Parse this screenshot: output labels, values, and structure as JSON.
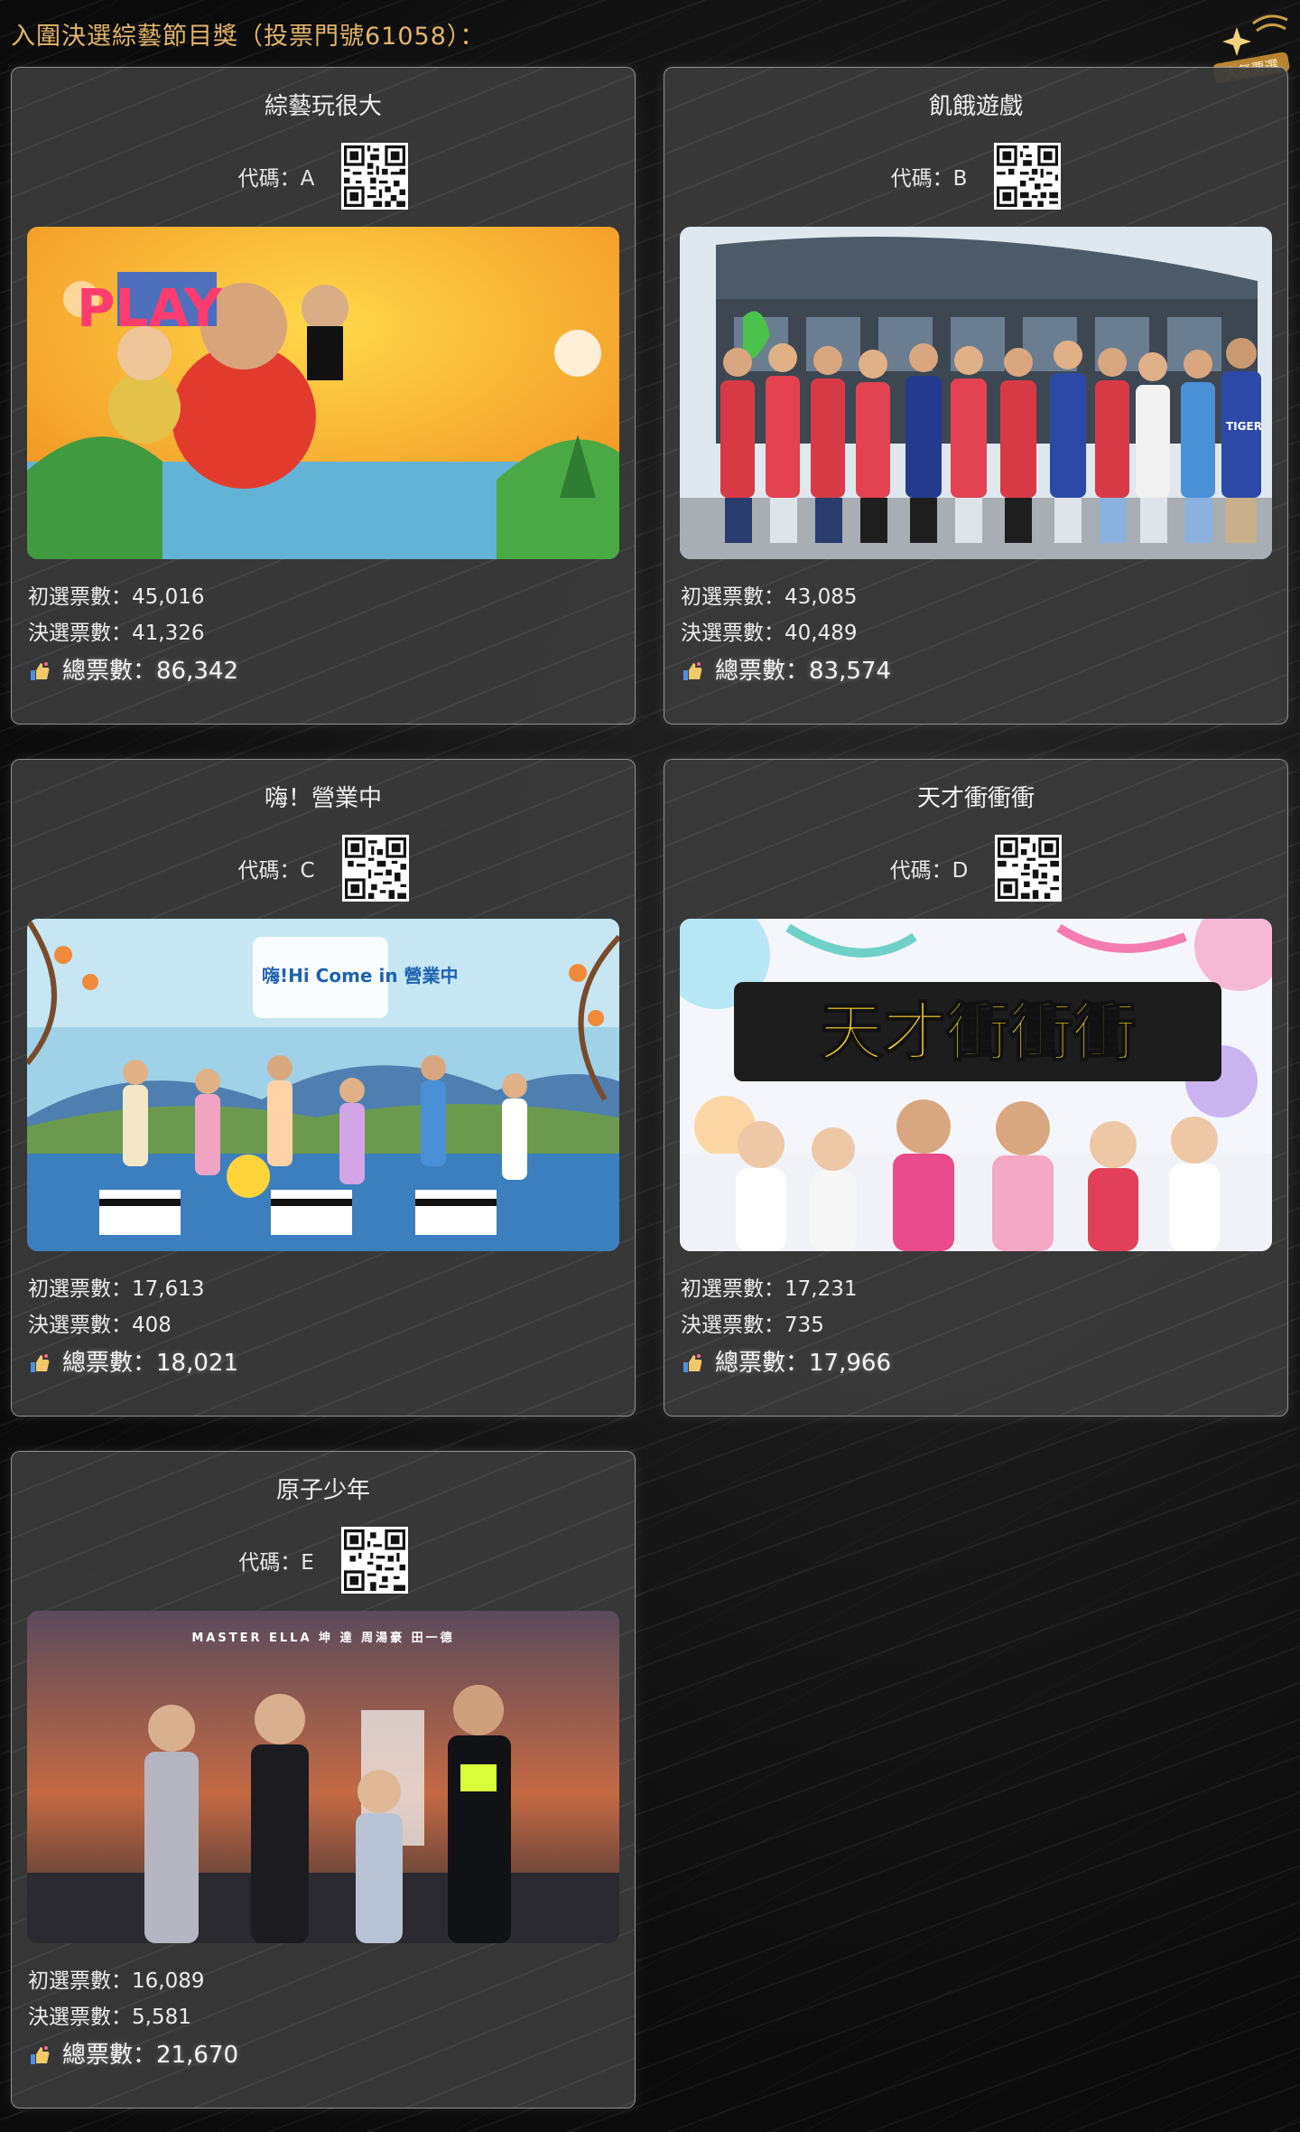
{
  "header": {
    "title": "入圍決選綜藝節目獎（投票門號61058）：",
    "badge_text": "人氣票選"
  },
  "labels": {
    "code_prefix": "代碼：",
    "prelim_prefix": "初選票數：",
    "final_prefix": "決選票數：",
    "total_prefix": "總票數："
  },
  "cards": [
    {
      "title": "綜藝玩很大",
      "code": "A",
      "prelim_votes": "45,016",
      "final_votes": "41,326",
      "total_votes": "86,342",
      "poster_text": "PLAY"
    },
    {
      "title": "飢餓遊戲",
      "code": "B",
      "prelim_votes": "43,085",
      "final_votes": "40,489",
      "total_votes": "83,574",
      "poster_text": "TIGER"
    },
    {
      "title": "嗨！營業中",
      "code": "C",
      "prelim_votes": "17,613",
      "final_votes": "408",
      "total_votes": "18,021",
      "poster_text": "嗨!Hi Come in 營業中"
    },
    {
      "title": "天才衝衝衝",
      "code": "D",
      "prelim_votes": "17,231",
      "final_votes": "735",
      "total_votes": "17,966",
      "poster_text": "天才衝衝衝"
    },
    {
      "title": "原子少年",
      "code": "E",
      "prelim_votes": "16,089",
      "final_votes": "5,581",
      "total_votes": "21,670",
      "poster_text": "MASTER ELLA 坤 達 周湯豪 田一德"
    }
  ]
}
